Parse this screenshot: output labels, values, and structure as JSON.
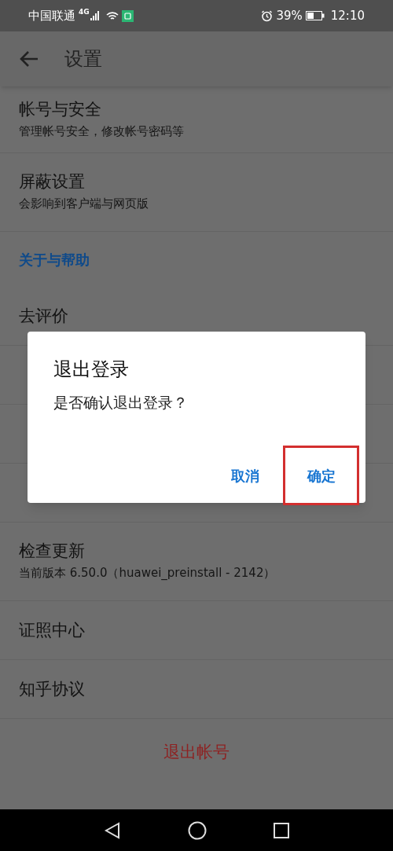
{
  "status_bar": {
    "carrier": "中国联通",
    "network": "4G",
    "battery": "39%",
    "time": "12:10"
  },
  "app_bar": {
    "title": "设置"
  },
  "settings": [
    {
      "kind": "item",
      "title": "帐号与安全",
      "subtitle": "管理帐号安全，修改帐号密码等"
    },
    {
      "kind": "item",
      "title": "屏蔽设置",
      "subtitle": "会影响到客户端与网页版"
    },
    {
      "kind": "header",
      "title": "关于与帮助"
    },
    {
      "kind": "item",
      "title": "去评价"
    },
    {
      "kind": "item"
    },
    {
      "kind": "item"
    },
    {
      "kind": "item"
    },
    {
      "kind": "item",
      "title": "检查更新",
      "subtitle": "当前版本 6.50.0（huawei_preinstall - 2142）"
    },
    {
      "kind": "item",
      "title": "证照中心"
    },
    {
      "kind": "item",
      "title": "知乎协议"
    },
    {
      "kind": "danger",
      "title": "退出帐号"
    }
  ],
  "dialog": {
    "title": "退出登录",
    "message": "是否确认退出登录？",
    "buttons": [
      {
        "label": "取消",
        "highlighted": false
      },
      {
        "label": "确定",
        "highlighted": true
      }
    ]
  }
}
